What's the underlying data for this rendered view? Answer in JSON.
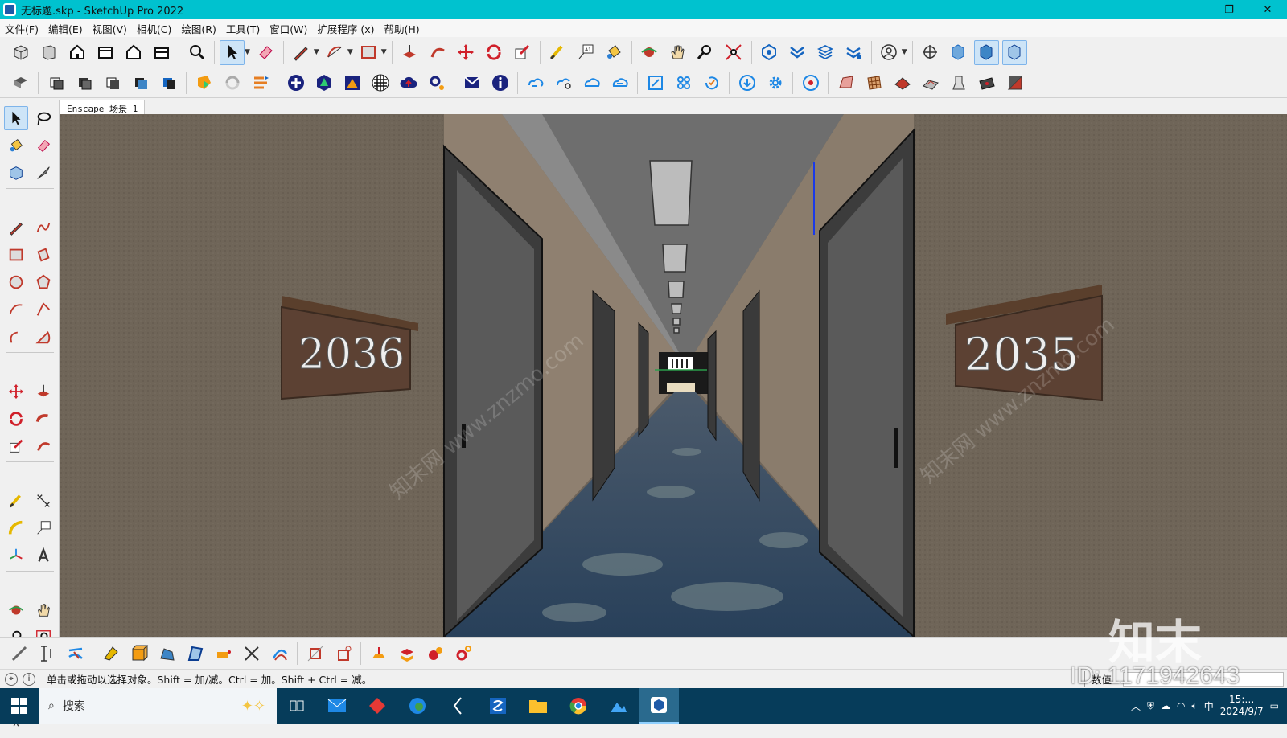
{
  "window": {
    "title": "无标题.skp - SketchUp Pro 2022",
    "controls": [
      "—",
      "❐",
      "✕"
    ]
  },
  "menu": [
    "文件(F)",
    "编辑(E)",
    "视图(V)",
    "相机(C)",
    "绘图(R)",
    "工具(T)",
    "窗口(W)",
    "扩展程序 (x)",
    "帮助(H)"
  ],
  "scene_tab": "Enscape 场景 1",
  "viewport": {
    "sign_left": "2036",
    "sign_right": "2035"
  },
  "status": {
    "message": "单击或拖动以选择对象。Shift = 加/减。Ctrl = 加。Shift + Ctrl = 减。",
    "value_label": "数值"
  },
  "taskbar": {
    "search_placeholder": "搜索",
    "time": "15:…",
    "date": "2024/9/7",
    "ime": "中"
  },
  "watermark": {
    "brand": "知末",
    "id": "ID: 1171942643",
    "site": "知末网 www.znzmo.com"
  }
}
